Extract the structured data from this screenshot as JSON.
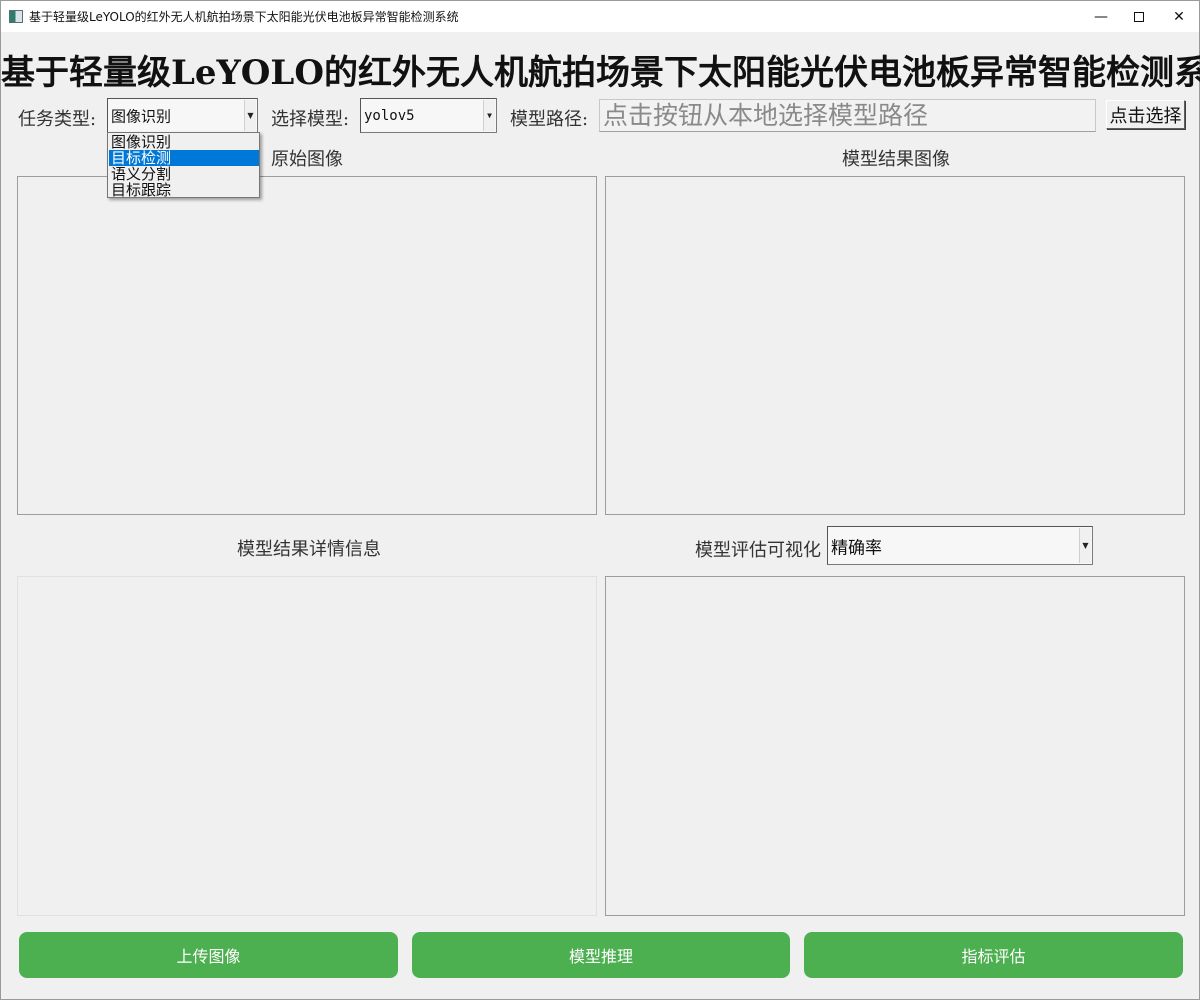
{
  "window": {
    "title": "基于轻量级LeYOLO的红外无人机航拍场景下太阳能光伏电池板异常智能检测系统",
    "minimize_glyph": "—",
    "close_glyph": "✕",
    "icon": "app-icon"
  },
  "header": {
    "title": "基于轻量级LeYOLO的红外无人机航拍场景下太阳能光伏电池板异常智能检测系统"
  },
  "toolbar": {
    "task_type_label": "任务类型:",
    "task_type_value": "图像识别",
    "task_type_options": [
      "图像识别",
      "目标检测",
      "语义分割",
      "目标跟踪"
    ],
    "task_type_highlighted": "目标检测",
    "model_label": "选择模型:",
    "model_value": "yolov5",
    "model_path_label": "模型路径:",
    "model_path_placeholder": "点击按钮从本地选择模型路径",
    "select_button": "点击选择"
  },
  "panels": {
    "original_image_title": "原始图像",
    "result_image_title": "模型结果图像",
    "details_title": "模型结果详情信息",
    "eval_title": "模型评估可视化",
    "eval_metric_value": "精确率"
  },
  "actions": {
    "upload": "上传图像",
    "infer": "模型推理",
    "evaluate": "指标评估"
  },
  "colors": {
    "action_button": "#4caf50",
    "selection": "#0078d7",
    "background": "#f0f0f0"
  }
}
